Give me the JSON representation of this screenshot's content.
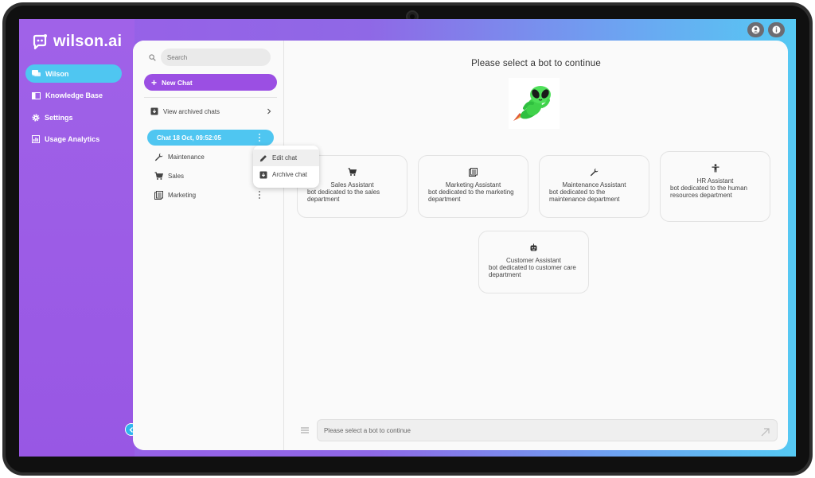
{
  "brand": {
    "name": "wilson.ai"
  },
  "nav": {
    "items": [
      {
        "label": "Wilson",
        "icon": "chat-bubbles-icon",
        "active": true
      },
      {
        "label": "Knowledge Base",
        "icon": "book-icon",
        "active": false
      },
      {
        "label": "Settings",
        "icon": "gear-icon",
        "active": false
      },
      {
        "label": "Usage Analytics",
        "icon": "analytics-icon",
        "active": false
      }
    ]
  },
  "sidebar": {
    "search_placeholder": "Search",
    "new_chat_label": "New Chat",
    "archived_label": "View archived chats",
    "chats": [
      {
        "label": "Chat 18 Oct, 09:52:05",
        "icon": "",
        "active": true
      },
      {
        "label": "Maintenance",
        "icon": "wrench-icon",
        "active": false
      },
      {
        "label": "Sales",
        "icon": "cart-icon",
        "active": false
      },
      {
        "label": "Marketing",
        "icon": "newspaper-icon",
        "active": false
      }
    ]
  },
  "context_menu": {
    "edit_label": "Edit chat",
    "archive_label": "Archive chat"
  },
  "main": {
    "title": "Please select a bot to continue",
    "bots": [
      {
        "name": "Sales Assistant",
        "description": "bot dedicated to the sales department",
        "icon": "cart-icon"
      },
      {
        "name": "Marketing Assistant",
        "description": "bot dedicated to the marketing department",
        "icon": "newspaper-icon"
      },
      {
        "name": "Maintenance Assistant",
        "description": "bot dedicated to the maintenance department",
        "icon": "wrench-icon"
      },
      {
        "name": "HR Assistant",
        "description": "bot dedicated to the human resources department",
        "icon": "person-icon"
      },
      {
        "name": "Customer Assistant",
        "description": "bot dedicated to customer care department",
        "icon": "robot-icon"
      }
    ],
    "composer_placeholder": "Please select a bot to continue"
  },
  "colors": {
    "accent_purple": "#9b4fe3",
    "accent_cyan": "#4fc6f1"
  }
}
